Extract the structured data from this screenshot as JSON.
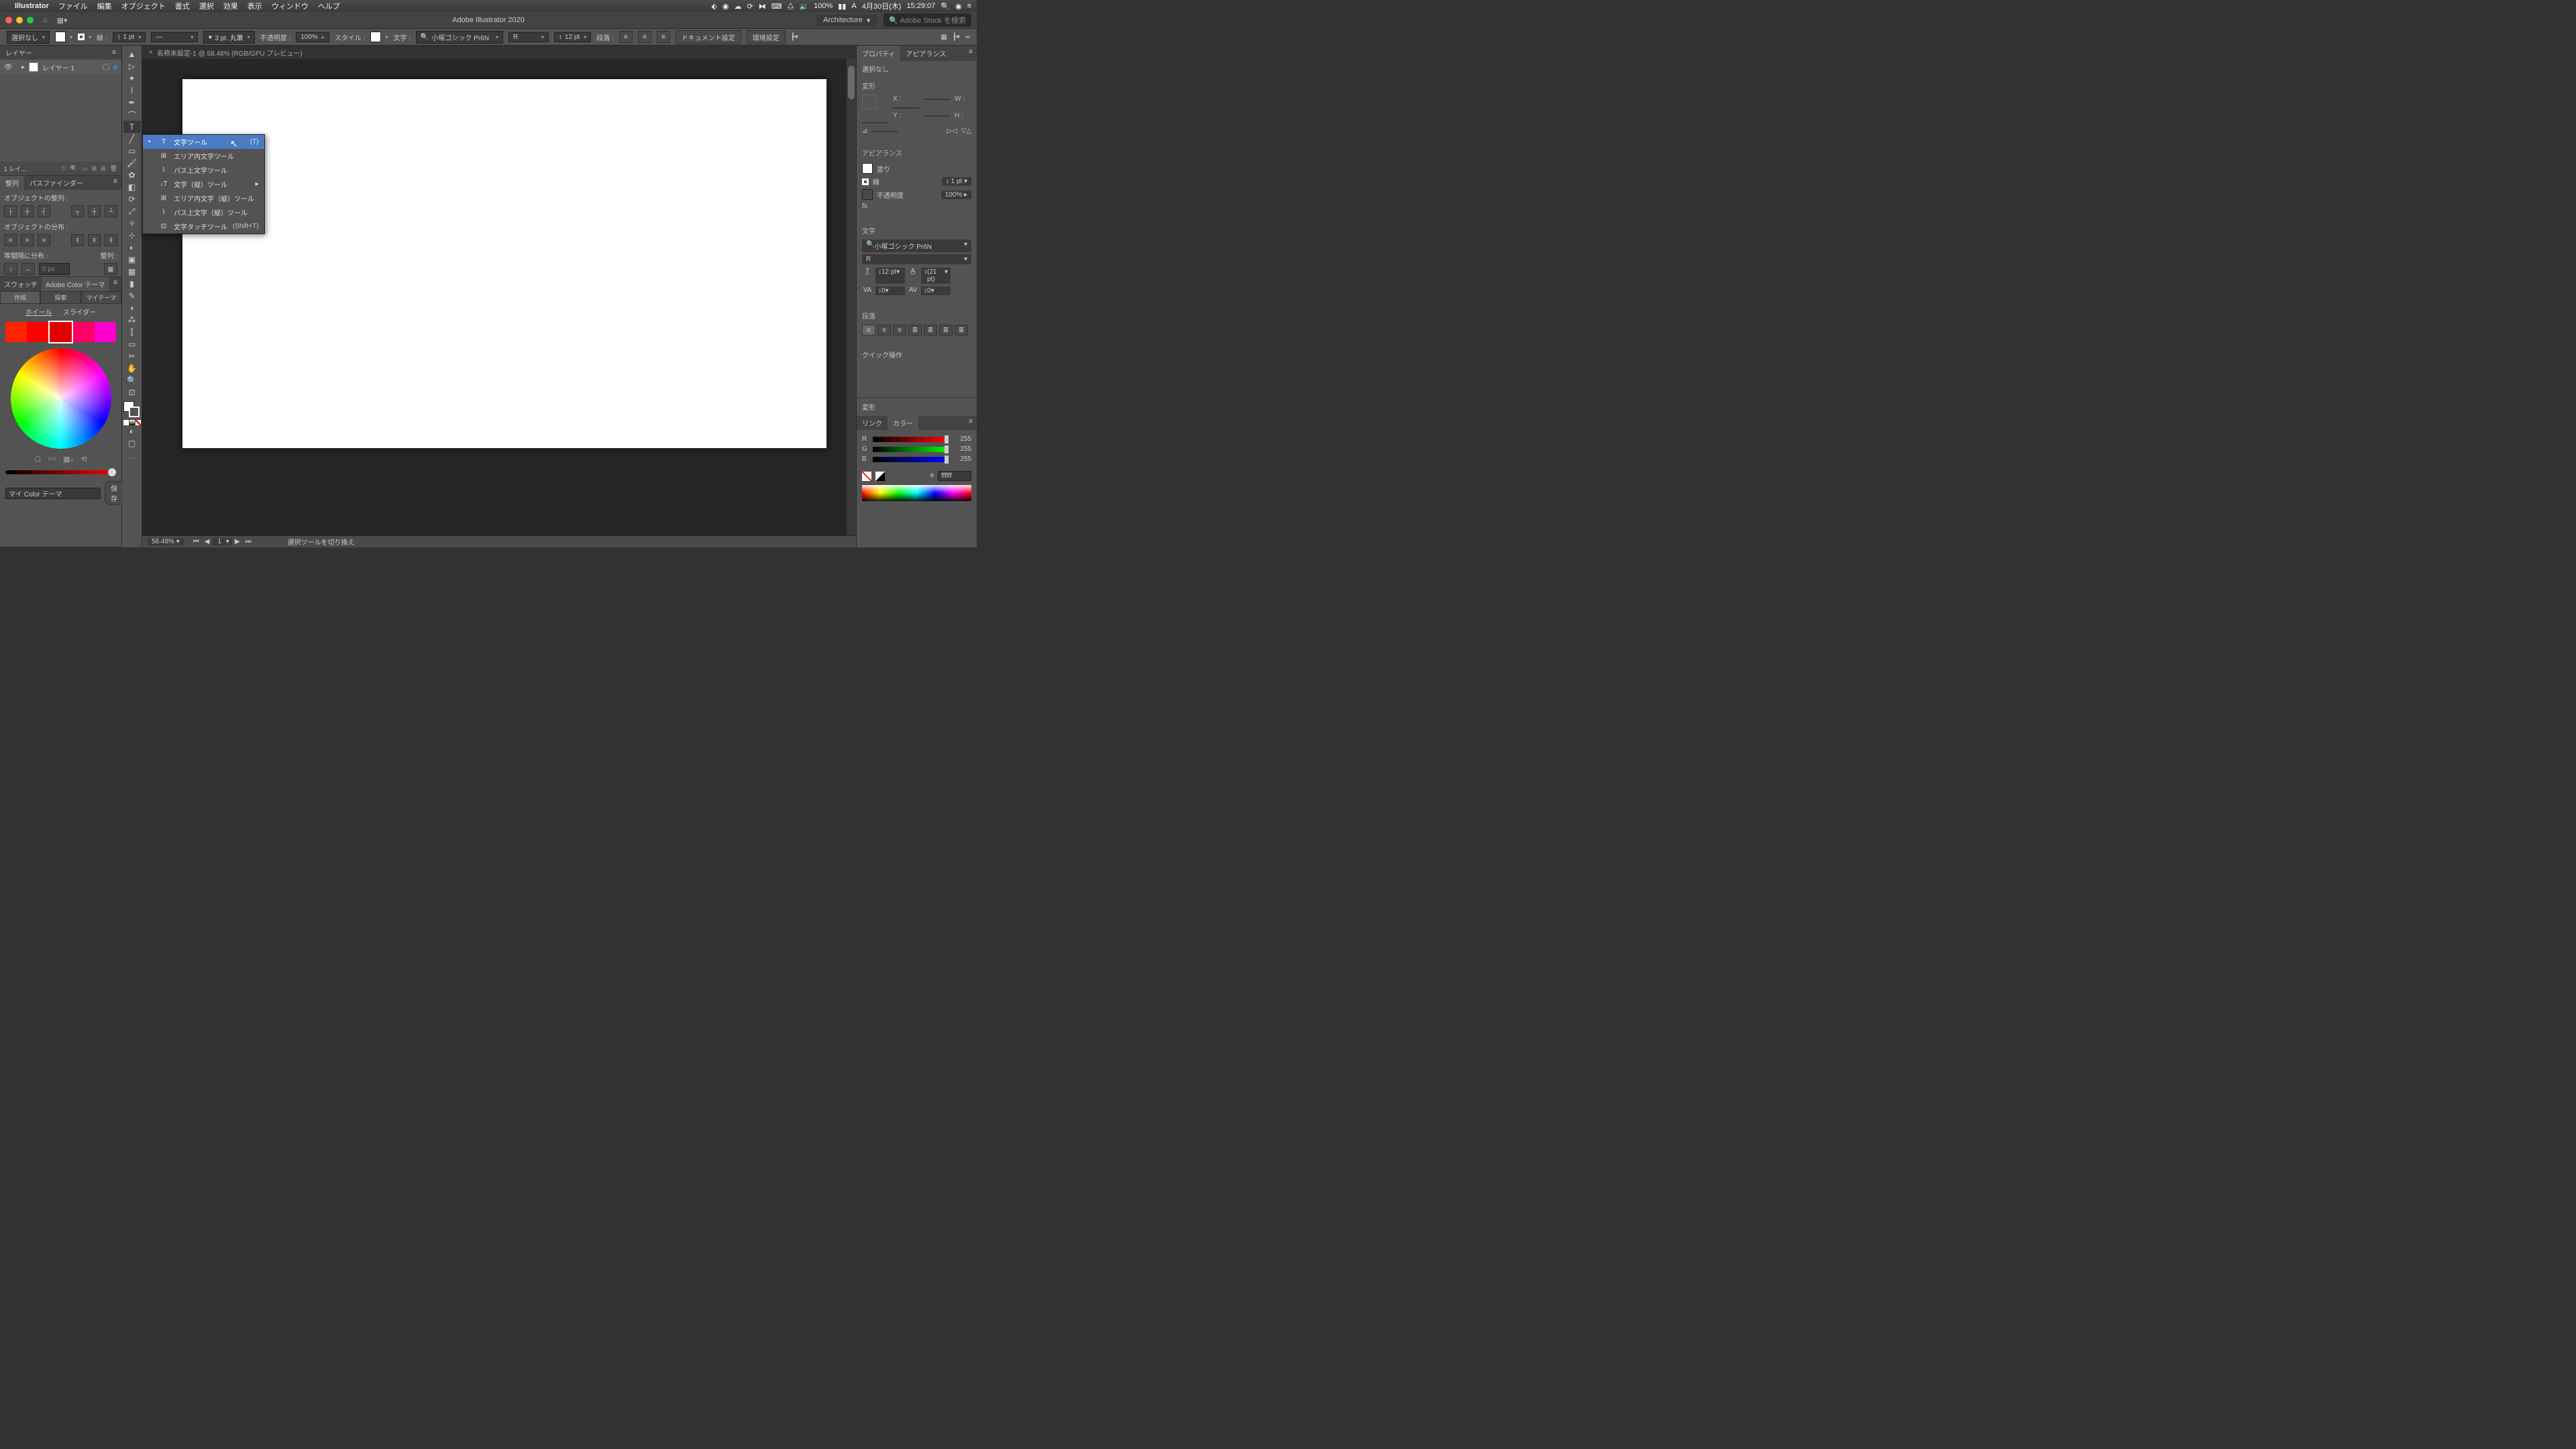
{
  "menubar": {
    "app": "Illustrator",
    "items": [
      "ファイル",
      "編集",
      "オブジェクト",
      "書式",
      "選択",
      "効果",
      "表示",
      "ウィンドウ",
      "ヘルプ"
    ],
    "battery": "100%",
    "date": "4月30日(木)",
    "time": "15:29:07"
  },
  "titlebar": {
    "app_title": "Adobe Illustrator 2020",
    "workspace": "Architecture",
    "search_placeholder": "Adobe Stock を検索"
  },
  "controlbar": {
    "no_selection": "選択なし",
    "stroke_label": "線 :",
    "stroke_weight": "1 pt",
    "brush": "3 pt. 丸筆",
    "opacity_label": "不透明度 :",
    "opacity_value": "100%",
    "style_label": "スタイル :",
    "char_label": "文字 :",
    "font_name": "小塚ゴシック Pr6N",
    "font_style": "R",
    "font_size": "12 pt",
    "para_label": "段落 :",
    "doc_setup": "ドキュメント設定",
    "prefs": "環境設定"
  },
  "layers_panel": {
    "title": "レイヤー",
    "layer1": "レイヤー 1",
    "footer": "1 レイ..."
  },
  "align_panel": {
    "tab_align": "整列",
    "tab_pathfinder": "パスファインダー",
    "sec_align": "オブジェクトの整列 :",
    "sec_dist": "オブジェクトの分布 :",
    "sec_space": "等間隔に分布 :",
    "align_to": "整列 :",
    "dist_val": "0 px"
  },
  "swatch_panel": {
    "tab_swatch": "スウォッチ",
    "tab_theme": "Adobe Color テーマ",
    "sub_create": "作成",
    "sub_explore": "探索",
    "sub_my": "マイテーマ",
    "wheel": "ホイール",
    "slider": "スライダー",
    "theme_name": "マイ Color テーマ",
    "save": "保存"
  },
  "flyout": {
    "items": [
      {
        "icon": "T",
        "label": "文字ツール",
        "kbd": "(T)",
        "active": true
      },
      {
        "icon": "⊞",
        "label": "エリア内文字ツール"
      },
      {
        "icon": "~",
        "label": "パス上文字ツール"
      },
      {
        "icon": "↓T",
        "label": "文字（縦）ツール",
        "sub": true
      },
      {
        "icon": "⊞",
        "label": "エリア内文字（縦）ツール"
      },
      {
        "icon": "~",
        "label": "パス上文字（縦）ツール"
      },
      {
        "icon": "⊡",
        "label": "文字タッチツール",
        "kbd": "(Shift+T)"
      }
    ]
  },
  "document": {
    "tab_label": "名称未設定-1 @ 58.48% (RGB/GPU プレビュー)",
    "zoom": "58.48%",
    "artboard_num": "1",
    "status_hint": "選択ツールを切り換え"
  },
  "props": {
    "tab_props": "プロパティ",
    "tab_appear": "アピアランス",
    "no_selection": "選択なし",
    "transform": "変形",
    "x": "X :",
    "y": "Y :",
    "w": "W :",
    "h": "H :",
    "appearance": "アピアランス",
    "fill": "塗り",
    "stroke": "線",
    "stroke_w": "1 pt",
    "opacity": "不透明度",
    "opacity_v": "100%",
    "fx": "fx.",
    "type": "文字",
    "font": "小塚ゴシック Pr6N",
    "style": "R",
    "size": "12 pt",
    "leading": "(21 pt)",
    "kern": "0",
    "track": "0",
    "para": "段落",
    "quick": "クイック操作",
    "transform2": "変形",
    "link": "リンク",
    "color": "カラー",
    "r": "R",
    "g": "G",
    "b": "B",
    "rv": "255",
    "gv": "255",
    "bv": "255",
    "hex_label": "#",
    "hex": "ffffff"
  }
}
